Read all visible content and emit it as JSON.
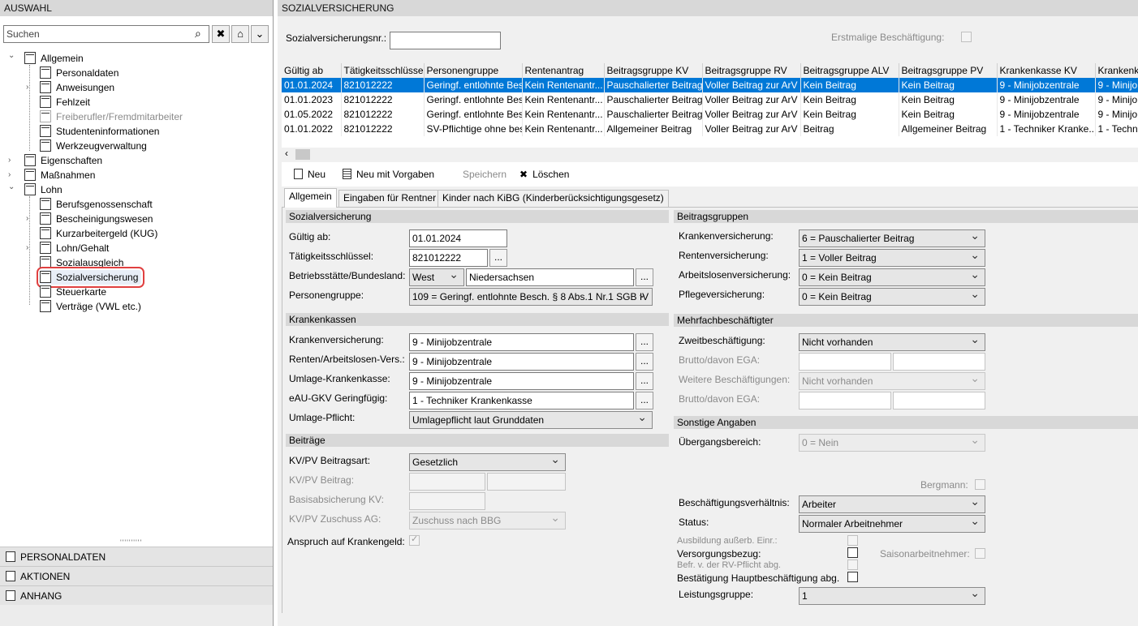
{
  "left_panel": {
    "title": "AUSWAHL",
    "search_placeholder": "Suchen",
    "tree": [
      {
        "label": "Allgemein",
        "level": 0,
        "expanded": true
      },
      {
        "label": "Personaldaten",
        "level": 1
      },
      {
        "label": "Anweisungen",
        "level": 1,
        "expandable": true
      },
      {
        "label": "Fehlzeit",
        "level": 1
      },
      {
        "label": "Freiberufler/Fremdmitarbeiter",
        "level": 1,
        "disabled": true
      },
      {
        "label": "Studenteninformationen",
        "level": 1
      },
      {
        "label": "Werkzeugverwaltung",
        "level": 1
      },
      {
        "label": "Eigenschaften",
        "level": 0,
        "expandable": true
      },
      {
        "label": "Maßnahmen",
        "level": 0,
        "expandable": true
      },
      {
        "label": "Lohn",
        "level": 0,
        "expanded": true
      },
      {
        "label": "Berufsgenossenschaft",
        "level": 1
      },
      {
        "label": "Bescheinigungswesen",
        "level": 1,
        "expandable": true
      },
      {
        "label": "Kurzarbeitergeld (KUG)",
        "level": 1
      },
      {
        "label": "Lohn/Gehalt",
        "level": 1,
        "expandable": true
      },
      {
        "label": "Sozialausgleich",
        "level": 1
      },
      {
        "label": "Sozialversicherung",
        "level": 1,
        "selected": true
      },
      {
        "label": "Steuerkarte",
        "level": 1
      },
      {
        "label": "Verträge (VWL etc.)",
        "level": 1
      }
    ],
    "sections": [
      "PERSONALDATEN",
      "AKTIONEN",
      "ANHANG"
    ]
  },
  "main": {
    "title": "SOZIALVERSICHERUNG",
    "svnr_label": "Sozialversicherungsnr.:",
    "svnr_value": "",
    "erstmalige_label": "Erstmalige Beschäftigung:",
    "table": {
      "columns": [
        "Gültig ab",
        "Tätigkeitsschlüssel",
        "Personengruppe",
        "Rentenantrag",
        "Beitragsgruppe KV",
        "Beitragsgruppe RV",
        "Beitragsgruppe ALV",
        "Beitragsgruppe PV",
        "Krankenkasse KV",
        "Krankenk"
      ],
      "rows": [
        [
          "01.01.2024",
          "821012222",
          "Geringf. entlohnte Besc",
          "Kein Rentenantr...",
          "Pauschalierter Beitrag",
          "Voller Beitrag zur ArV",
          "Kein Beitrag",
          "Kein Beitrag",
          "9 - Minijobzentrale",
          "9 - Minijo"
        ],
        [
          "01.01.2023",
          "821012222",
          "Geringf. entlohnte Besc",
          "Kein Rentenantr...",
          "Pauschalierter Beitrag",
          "Voller Beitrag zur ArV",
          "Kein Beitrag",
          "Kein Beitrag",
          "9 - Minijobzentrale",
          "9 - Minijo"
        ],
        [
          "01.05.2022",
          "821012222",
          "Geringf. entlohnte Besc",
          "Kein Rentenantr...",
          "Pauschalierter Beitrag",
          "Voller Beitrag zur ArV",
          "Kein Beitrag",
          "Kein Beitrag",
          "9 - Minijobzentrale",
          "9 - Minijo"
        ],
        [
          "01.01.2022",
          "821012222",
          "SV-Pflichtige ohne bes",
          "Kein Rentenantr...",
          "Allgemeiner Beitrag",
          "Voller Beitrag zur ArV",
          "Beitrag",
          "Allgemeiner Beitrag",
          "1 - Techniker Kranke...",
          "1 - Techn"
        ]
      ]
    },
    "toolbar": {
      "new": "Neu",
      "new_template": "Neu mit Vorgaben",
      "save": "Speichern",
      "delete": "Löschen"
    },
    "tabs": [
      "Allgemein",
      "Eingaben für Rentner",
      "Kinder nach KiBG (Kinderberücksichtigungsgesetz)"
    ],
    "sv": {
      "header": "Sozialversicherung",
      "gueltig_label": "Gültig ab:",
      "gueltig_value": "01.01.2024",
      "taetigkeit_label": "Tätigkeitsschlüssel:",
      "taetigkeit_value": "821012222",
      "betrieb_label": "Betriebsstätte/Bundesland:",
      "betrieb_region": "West",
      "betrieb_land": "Niedersachsen",
      "personen_label": "Personengruppe:",
      "personen_value": "109 = Geringf. entlohnte Besch. § 8 Abs.1 Nr.1 SGB IV"
    },
    "kk": {
      "header": "Krankenkassen",
      "kv_label": "Krankenversicherung:",
      "kv_value": "9 - Minijobzentrale",
      "rv_label": "Renten/Arbeitslosen-Vers.:",
      "rv_value": "9 - Minijobzentrale",
      "umlage_label": "Umlage-Krankenkasse:",
      "umlage_value": "9 - Minijobzentrale",
      "eau_label": "eAU-GKV Geringfügig:",
      "eau_value": "1 - Techniker Krankenkasse",
      "pflicht_label": "Umlage-Pflicht:",
      "pflicht_value": "Umlagepflicht laut Grunddaten"
    },
    "beitraege": {
      "header": "Beiträge",
      "art_label": "KV/PV Beitragsart:",
      "art_value": "Gesetzlich",
      "beitrag_label": "KV/PV Beitrag:",
      "basis_label": "Basisabsicherung KV:",
      "zuschuss_label": "KV/PV Zuschuss AG:",
      "zuschuss_value": "Zuschuss nach BBG",
      "anspruch_label": "Anspruch auf Krankengeld:",
      "anspruch_mark": "✓"
    },
    "bg": {
      "header": "Beitragsgruppen",
      "kv_label": "Krankenversicherung:",
      "kv_value": "6 = Pauschalierter Beitrag",
      "rv_label": "Rentenversicherung:",
      "rv_value": "1 = Voller Beitrag",
      "alv_label": "Arbeitslosenversicherung:",
      "alv_value": "0 = Kein Beitrag",
      "pv_label": "Pflegeversicherung:",
      "pv_value": "0 = Kein Beitrag"
    },
    "mehrfach": {
      "header": "Mehrfachbeschäftigter",
      "zweit_label": "Zweitbeschäftigung:",
      "zweit_value": "Nicht vorhanden",
      "brutto1_label": "Brutto/davon EGA:",
      "weitere_label": "Weitere Beschäftigungen:",
      "weitere_value": "Nicht vorhanden",
      "brutto2_label": "Brutto/davon EGA:"
    },
    "sonstige": {
      "header": "Sonstige Angaben",
      "ueber_label": "Übergangsbereich:",
      "ueber_value": "0 = Nein",
      "bergmann_label": "Bergmann:",
      "verh_label": "Beschäftigungsverhältnis:",
      "verh_value": "Arbeiter",
      "status_label": "Status:",
      "status_value": "Normaler Arbeitnehmer",
      "ausbildung_label": "Ausbildung außerb. Einr.:",
      "versorgung_label": "Versorgungsbezug:",
      "saison_label": "Saisonarbeitnehmer:",
      "befr_label": "Befr. v. der RV-Pflicht abg.",
      "bestaetigung_label": "Bestätigung Hauptbeschäftigung abg.",
      "leistung_label": "Leistungsgruppe:",
      "leistung_value": "1"
    }
  },
  "colors": {
    "selection": "#0078d7",
    "highlight_border": "#e04040",
    "section_bg": "#d8d8d8"
  }
}
